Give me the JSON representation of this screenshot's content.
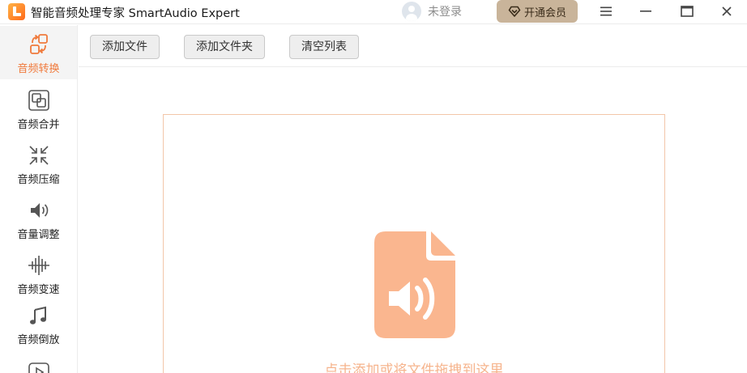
{
  "window": {
    "title": "智能音频处理专家 SmartAudio Expert",
    "user_label": "未登录",
    "vip_label": "开通会员"
  },
  "colors": {
    "accent": "#f07a3c",
    "vip_bg": "#c9b49a",
    "drop_icon": "#fab68f",
    "drop_text": "#f6b48d"
  },
  "sidebar": {
    "items": [
      {
        "label": "音频转换",
        "icon": "convert-icon",
        "active": true
      },
      {
        "label": "音频合并",
        "icon": "merge-icon",
        "active": false
      },
      {
        "label": "音频压缩",
        "icon": "compress-icon",
        "active": false
      },
      {
        "label": "音量调整",
        "icon": "volume-icon",
        "active": false
      },
      {
        "label": "音频变速",
        "icon": "waveform-icon",
        "active": false
      },
      {
        "label": "音频倒放",
        "icon": "music-note-icon",
        "active": false
      },
      {
        "label": "",
        "icon": "play-icon",
        "active": false
      }
    ]
  },
  "toolbar": {
    "add_file": "添加文件",
    "add_folder": "添加文件夹",
    "clear_list": "清空列表"
  },
  "dropzone": {
    "hint": "点击添加或将文件拖拽到这里",
    "icon": "audio-file-icon"
  }
}
